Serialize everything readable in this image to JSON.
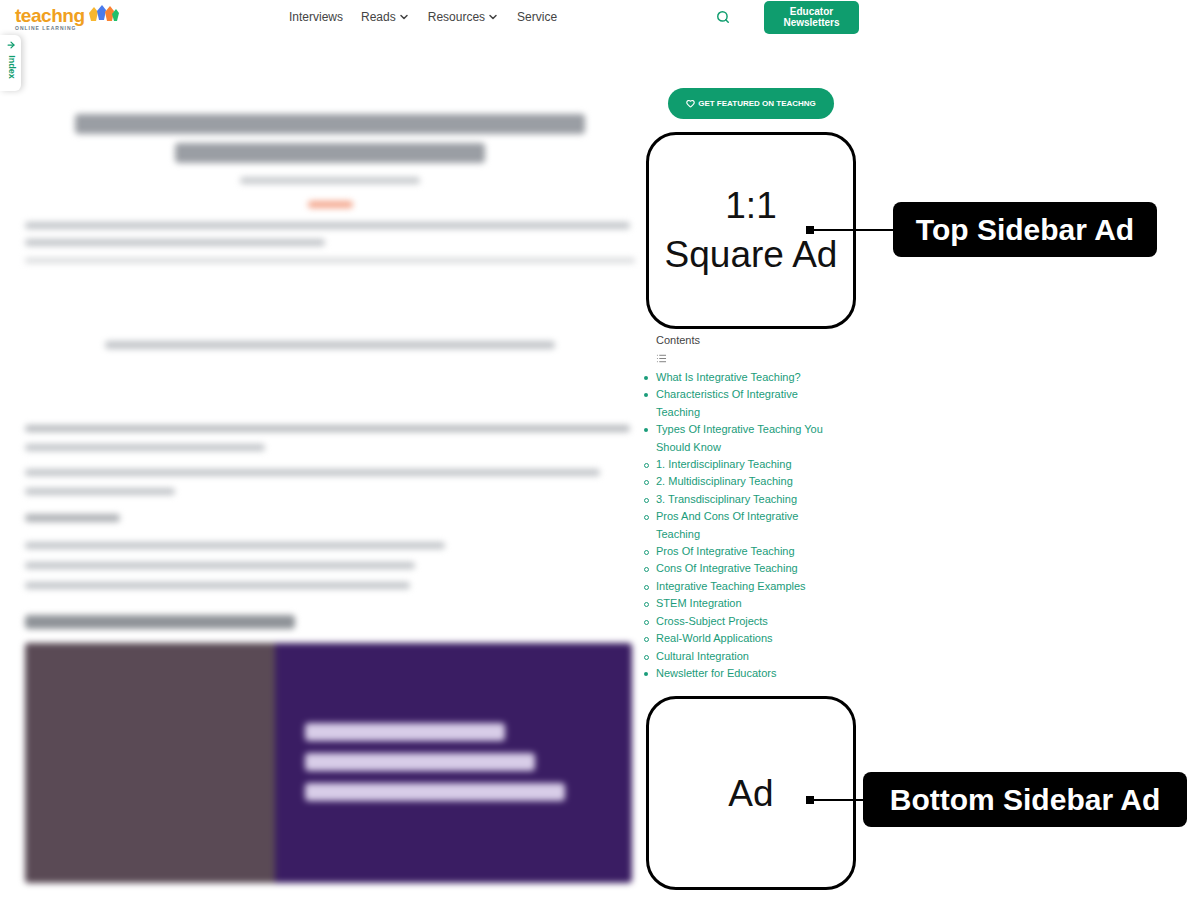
{
  "header": {
    "logo": {
      "name": "teachng",
      "tagline": "ONLINE LEARNING"
    },
    "nav": [
      {
        "label": "Interviews",
        "dropdown": false
      },
      {
        "label": "Reads",
        "dropdown": true
      },
      {
        "label": "Resources",
        "dropdown": true
      },
      {
        "label": "Service",
        "dropdown": false
      }
    ],
    "newsletter_button": "Educator Newsletters"
  },
  "index_tab": {
    "label": "Index"
  },
  "sidebar": {
    "featured_button": "GET FEATURED ON TEACHNG",
    "top_ad": {
      "ratio": "1:1",
      "label": "Square Ad"
    },
    "contents": {
      "title": "Contents",
      "items": [
        {
          "label": "What Is Integrative Teaching?",
          "kind": "section"
        },
        {
          "label": "Characteristics Of Integrative Teaching",
          "kind": "section"
        },
        {
          "label": "Types Of Integrative Teaching You Should Know",
          "kind": "section"
        },
        {
          "label": "1. Interdisciplinary Teaching",
          "kind": "subsection"
        },
        {
          "label": "2. Multidisciplinary Teaching",
          "kind": "subsection"
        },
        {
          "label": "3. Transdisciplinary Teaching",
          "kind": "subsection"
        },
        {
          "label": "Pros And Cons Of Integrative Teaching",
          "kind": "subsection"
        },
        {
          "label": "Pros Of Integrative Teaching",
          "kind": "subsection"
        },
        {
          "label": "Cons Of Integrative Teaching",
          "kind": "subsection"
        },
        {
          "label": "Integrative Teaching Examples",
          "kind": "subsection"
        },
        {
          "label": "STEM Integration",
          "kind": "subsection"
        },
        {
          "label": "Cross-Subject Projects",
          "kind": "subsection"
        },
        {
          "label": "Real-World Applications",
          "kind": "subsection"
        },
        {
          "label": "Cultural Integration",
          "kind": "subsection"
        },
        {
          "label": "Newsletter for Educators",
          "kind": "section"
        }
      ]
    },
    "bottom_ad": {
      "label": "Ad"
    }
  },
  "annotations": [
    {
      "label": "Top Sidebar Ad"
    },
    {
      "label": "Bottom Sidebar Ad"
    }
  ]
}
